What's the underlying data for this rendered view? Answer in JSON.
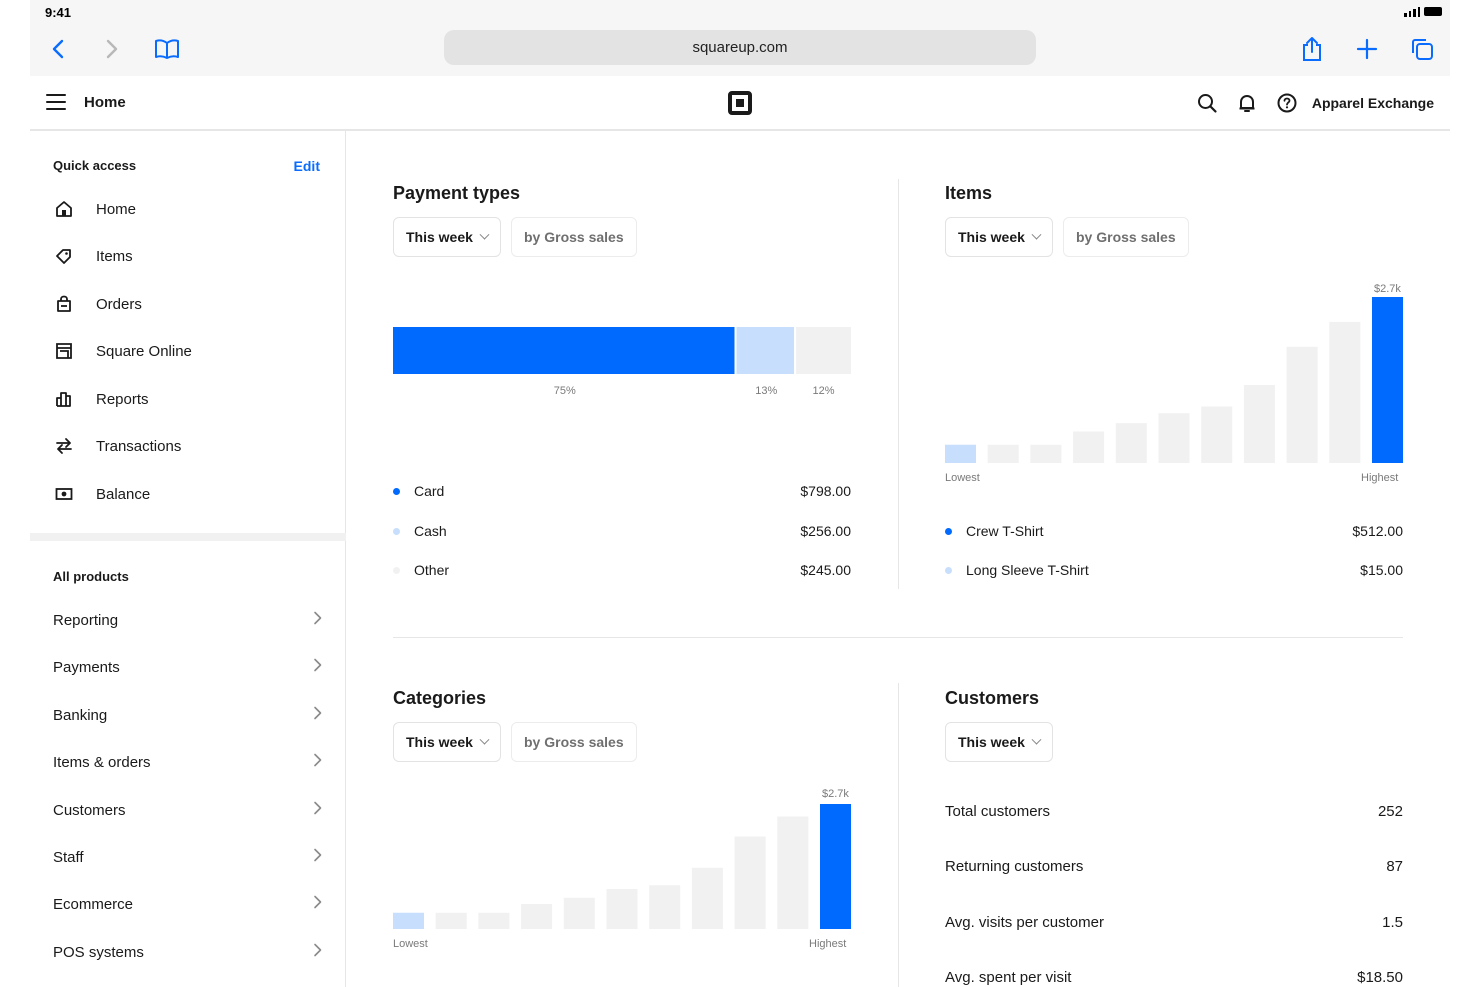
{
  "status_bar": {
    "time": "9:41"
  },
  "browser": {
    "url": "squareup.com"
  },
  "header": {
    "title": "Home",
    "account": "Apparel Exchange"
  },
  "sidebar": {
    "quick_access_title": "Quick access",
    "edit_label": "Edit",
    "quick_access": [
      {
        "label": "Home",
        "icon": "home-icon"
      },
      {
        "label": "Items",
        "icon": "tag-icon"
      },
      {
        "label": "Orders",
        "icon": "bag-icon"
      },
      {
        "label": "Square Online",
        "icon": "storefront-icon"
      },
      {
        "label": "Reports",
        "icon": "bar-chart-icon"
      },
      {
        "label": "Transactions",
        "icon": "swap-arrows-icon"
      },
      {
        "label": "Balance",
        "icon": "cash-icon"
      }
    ],
    "all_products_title": "All products",
    "all_products": [
      {
        "label": "Reporting"
      },
      {
        "label": "Payments"
      },
      {
        "label": "Banking"
      },
      {
        "label": "Items & orders"
      },
      {
        "label": "Customers"
      },
      {
        "label": "Staff"
      },
      {
        "label": "Ecommerce"
      },
      {
        "label": "POS systems"
      }
    ]
  },
  "colors": {
    "accent": "#006aff",
    "light": "#c7dffc",
    "bar_grey": "#f1f1f1"
  },
  "payment_types": {
    "title": "Payment types",
    "period": "This week",
    "metric": "by Gross sales",
    "segments": [
      {
        "name": "Card",
        "percent_label": "75%",
        "share": 0.75,
        "amount": "$798.00",
        "color": "#006aff"
      },
      {
        "name": "Cash",
        "percent_label": "13%",
        "share": 0.13,
        "amount": "$256.00",
        "color": "#c7dffc"
      },
      {
        "name": "Other",
        "percent_label": "12%",
        "share": 0.12,
        "amount": "$245.00",
        "color": "#f1f1f1"
      }
    ]
  },
  "items": {
    "title": "Items",
    "period": "This week",
    "metric": "by Gross sales",
    "top_label": "$2.7k",
    "lowest_label": "Lowest",
    "highest_label": "Highest",
    "legend": [
      {
        "name": "Crew T-Shirt",
        "amount": "$512.00",
        "color": "#006aff"
      },
      {
        "name": "Long Sleeve T-Shirt",
        "amount": "$15.00",
        "color": "#c7dffc"
      }
    ]
  },
  "categories": {
    "title": "Categories",
    "period": "This week",
    "metric": "by Gross sales",
    "top_label": "$2.7k",
    "lowest_label": "Lowest",
    "highest_label": "Highest"
  },
  "customers": {
    "title": "Customers",
    "period": "This week",
    "stats": [
      {
        "label": "Total customers",
        "value": "252"
      },
      {
        "label": "Returning customers",
        "value": "87"
      },
      {
        "label": "Avg. visits per customer",
        "value": "1.5"
      },
      {
        "label": "Avg. spent per visit",
        "value": "$18.50"
      }
    ]
  },
  "chart_data": [
    {
      "type": "bar",
      "title": "Items",
      "categories": [
        "1",
        "2",
        "3",
        "4",
        "5",
        "6",
        "7",
        "8",
        "9",
        "10",
        "11"
      ],
      "values": [
        0.11,
        0.11,
        0.11,
        0.19,
        0.24,
        0.3,
        0.34,
        0.47,
        0.7,
        0.85,
        1.0
      ],
      "ylim": [
        0,
        1
      ],
      "max_label": "$2.7k"
    },
    {
      "type": "bar",
      "title": "Categories",
      "categories": [
        "1",
        "2",
        "3",
        "4",
        "5",
        "6",
        "7",
        "8",
        "9",
        "10",
        "11"
      ],
      "values": [
        0.13,
        0.13,
        0.13,
        0.2,
        0.25,
        0.32,
        0.35,
        0.49,
        0.74,
        0.9,
        1.0
      ],
      "ylim": [
        0,
        1
      ],
      "max_label": "$2.7k"
    }
  ]
}
